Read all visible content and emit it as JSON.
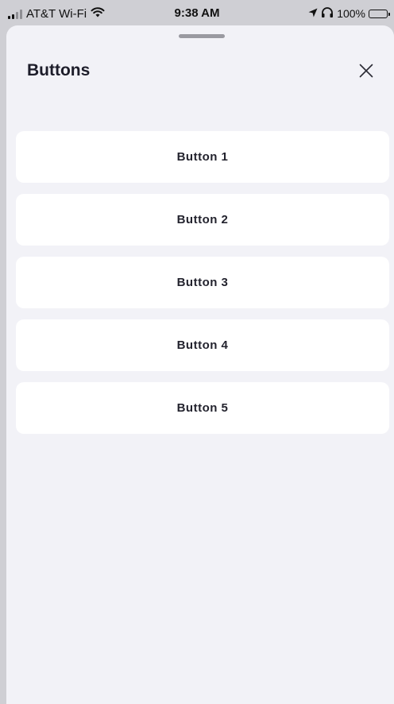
{
  "status_bar": {
    "carrier": "AT&T Wi-Fi",
    "time": "9:38 AM",
    "battery": "100%",
    "icons": [
      "signal-icon",
      "wifi-icon",
      "location-arrow-icon",
      "headphones-icon",
      "battery-icon"
    ]
  },
  "sheet": {
    "title": "Buttons",
    "close_icon": "close-icon"
  },
  "buttons": [
    {
      "label": "Button 1"
    },
    {
      "label": "Button 2"
    },
    {
      "label": "Button 3"
    },
    {
      "label": "Button 4"
    },
    {
      "label": "Button 5"
    }
  ],
  "colors": {
    "sheet_background": "#f2f2f7",
    "button_background": "#ffffff",
    "text": "#1d1d2a"
  }
}
